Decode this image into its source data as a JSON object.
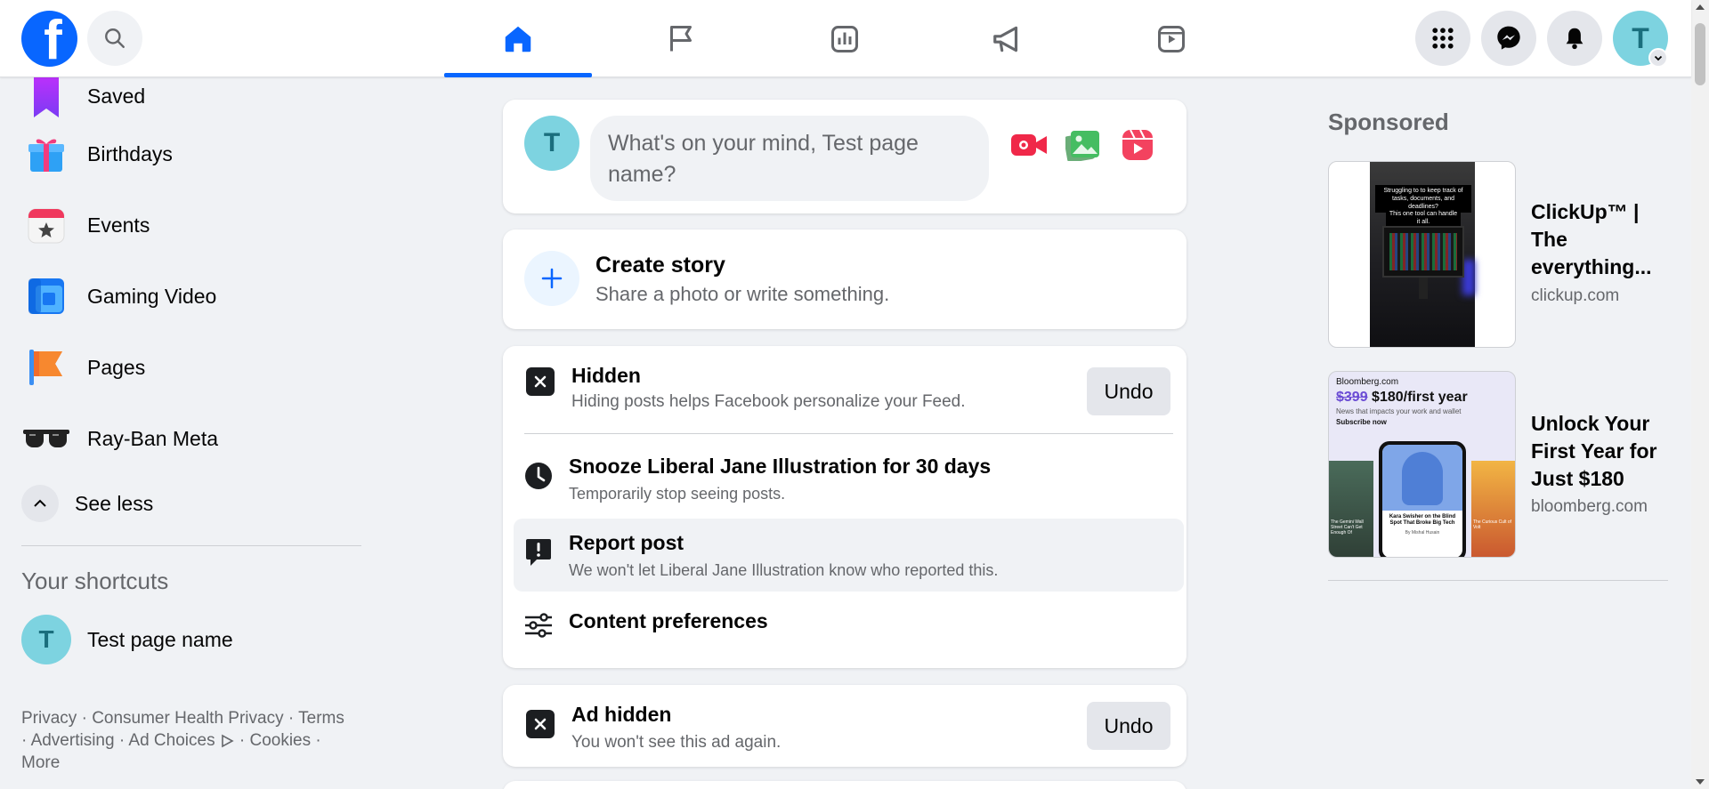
{
  "colors": {
    "brand": "#0866ff",
    "avatar_bg": "#7dd3e0",
    "page_bg": "#f0f2f5"
  },
  "header": {
    "logo_letter": "f",
    "tabs": [
      {
        "name": "home",
        "icon": "home-icon",
        "active": true
      },
      {
        "name": "pages",
        "icon": "flag-icon",
        "active": false
      },
      {
        "name": "insights",
        "icon": "bar-chart-icon",
        "active": false
      },
      {
        "name": "ads",
        "icon": "megaphone-icon",
        "active": false
      },
      {
        "name": "reels",
        "icon": "video-play-icon",
        "active": false
      }
    ],
    "avatar_letter": "T"
  },
  "sidebar": {
    "items": [
      {
        "label": "Saved",
        "icon": "bookmark-icon"
      },
      {
        "label": "Birthdays",
        "icon": "gift-icon"
      },
      {
        "label": "Events",
        "icon": "calendar-star-icon"
      },
      {
        "label": "Gaming Video",
        "icon": "gaming-video-icon"
      },
      {
        "label": "Pages",
        "icon": "flag-icon"
      },
      {
        "label": "Ray-Ban Meta",
        "icon": "sunglasses-icon"
      }
    ],
    "see_less": "See less",
    "shortcuts_title": "Your shortcuts",
    "shortcut": {
      "letter": "T",
      "label": "Test page name"
    }
  },
  "footer": {
    "links": [
      "Privacy",
      "Consumer Health Privacy",
      "Terms",
      "Advertising",
      "Ad Choices",
      "Cookies",
      "More"
    ],
    "sep": " · "
  },
  "composer": {
    "avatar_letter": "T",
    "placeholder": "What's on your mind, Test page name?"
  },
  "story": {
    "title": "Create story",
    "subtitle": "Share a photo or write something."
  },
  "hidden_card": {
    "title": "Hidden",
    "subtitle": "Hiding posts helps Facebook personalize your Feed.",
    "undo": "Undo",
    "options": [
      {
        "title": "Snooze Liberal Jane Illustration for 30 days",
        "subtitle": "Temporarily stop seeing posts.",
        "icon": "clock-icon"
      },
      {
        "title": "Report post",
        "subtitle": "We won't let Liberal Jane Illustration know who reported this.",
        "icon": "report-icon"
      },
      {
        "title": "Content preferences",
        "subtitle": "",
        "icon": "sliders-icon"
      }
    ]
  },
  "ad_hidden_card": {
    "title": "Ad hidden",
    "subtitle": "You won't see this ad again.",
    "undo": "Undo"
  },
  "right": {
    "sponsored": "Sponsored",
    "ads": [
      {
        "title": "ClickUp™ | The everything...",
        "domain": "clickup.com",
        "thumb_text_1": "Struggling to to keep track of tasks, documents, and deadlines?",
        "thumb_text_2": "This one tool can handle it all."
      },
      {
        "title": "Unlock Your First Year for Just $180",
        "domain": "bloomberg.com",
        "thumb_brand": "Bloomberg.com",
        "thumb_old_price": "$399",
        "thumb_price": "$180/first year",
        "thumb_tagline": "News that impacts your work and wallet",
        "thumb_cta": "Subscribe now",
        "thumb_headline": "Kara Swisher on the Blind Spot That Broke Big Tech",
        "thumb_byline": "By Mishal Husain",
        "thumb_side_left": "The Gemini Wall Street Can't Get Enough Of",
        "thumb_side_right": "The Curious Cult of Volt"
      }
    ]
  }
}
